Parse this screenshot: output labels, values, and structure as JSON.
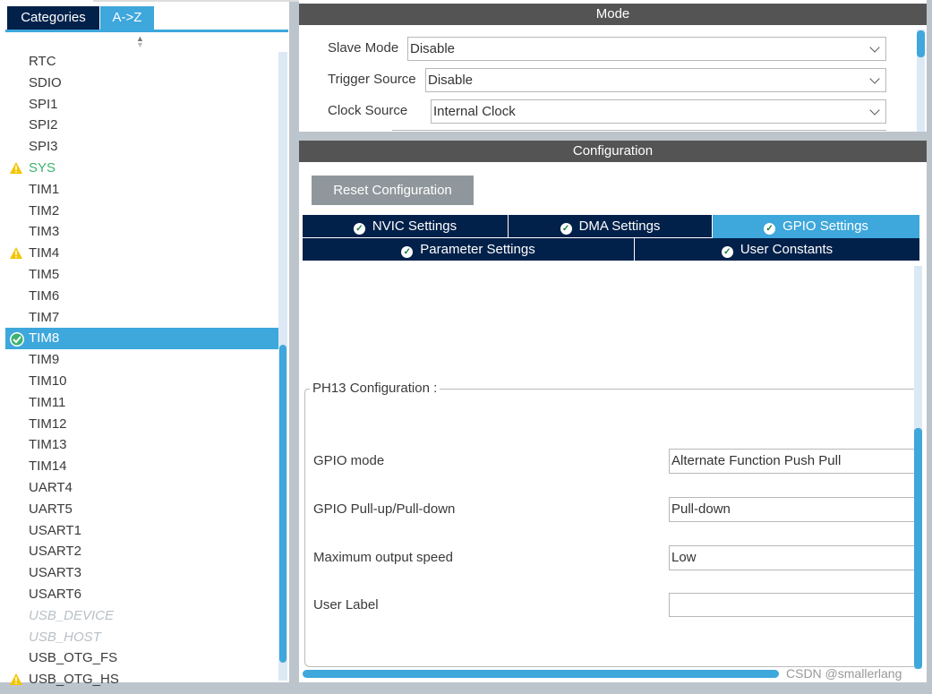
{
  "left": {
    "tabs": [
      {
        "label": "Categories",
        "active": false
      },
      {
        "label": "A->Z",
        "active": true
      }
    ],
    "items": [
      {
        "label": "RTC",
        "status": "none"
      },
      {
        "label": "SDIO",
        "status": "none"
      },
      {
        "label": "SPI1",
        "status": "none"
      },
      {
        "label": "SPI2",
        "status": "none"
      },
      {
        "label": "SPI3",
        "status": "none"
      },
      {
        "label": "SYS",
        "status": "warning"
      },
      {
        "label": "TIM1",
        "status": "none"
      },
      {
        "label": "TIM2",
        "status": "none"
      },
      {
        "label": "TIM3",
        "status": "none"
      },
      {
        "label": "TIM4",
        "status": "warning"
      },
      {
        "label": "TIM5",
        "status": "none"
      },
      {
        "label": "TIM6",
        "status": "none"
      },
      {
        "label": "TIM7",
        "status": "none"
      },
      {
        "label": "TIM8",
        "status": "selected"
      },
      {
        "label": "TIM9",
        "status": "none"
      },
      {
        "label": "TIM10",
        "status": "none"
      },
      {
        "label": "TIM11",
        "status": "none"
      },
      {
        "label": "TIM12",
        "status": "none"
      },
      {
        "label": "TIM13",
        "status": "none"
      },
      {
        "label": "TIM14",
        "status": "none"
      },
      {
        "label": "UART4",
        "status": "none"
      },
      {
        "label": "UART5",
        "status": "none"
      },
      {
        "label": "USART1",
        "status": "none"
      },
      {
        "label": "USART2",
        "status": "none"
      },
      {
        "label": "USART3",
        "status": "none"
      },
      {
        "label": "USART6",
        "status": "none"
      },
      {
        "label": "USB_DEVICE",
        "status": "disabled"
      },
      {
        "label": "USB_HOST",
        "status": "disabled"
      },
      {
        "label": "USB_OTG_FS",
        "status": "none"
      },
      {
        "label": "USB_OTG_HS",
        "status": "warning"
      }
    ]
  },
  "mode": {
    "title": "Mode",
    "fields": [
      {
        "label": "Slave Mode",
        "value": "Disable"
      },
      {
        "label": "Trigger Source",
        "value": "Disable"
      },
      {
        "label": "Clock Source",
        "value": "Internal Clock"
      }
    ]
  },
  "config": {
    "title": "Configuration",
    "reset_label": "Reset Configuration",
    "tabs_row1": [
      {
        "label": "NVIC Settings",
        "active": false
      },
      {
        "label": "DMA Settings",
        "active": false
      },
      {
        "label": "GPIO Settings",
        "active": true
      }
    ],
    "tabs_row2": [
      {
        "label": "Parameter Settings"
      },
      {
        "label": "User Constants"
      }
    ],
    "group_title": "PH13 Configuration :",
    "fields": [
      {
        "label": "GPIO mode",
        "value": "Alternate Function Push Pull"
      },
      {
        "label": "GPIO Pull-up/Pull-down",
        "value": "Pull-down"
      },
      {
        "label": "Maximum output speed",
        "value": "Low"
      },
      {
        "label": "User Label",
        "value": ""
      }
    ]
  },
  "watermark": "CSDN @smallerlang",
  "colors": {
    "accent": "#3ea7dc",
    "dark_tab": "#02214a",
    "header": "#545454",
    "warning": "#f5c400",
    "ok": "#3cb371"
  }
}
